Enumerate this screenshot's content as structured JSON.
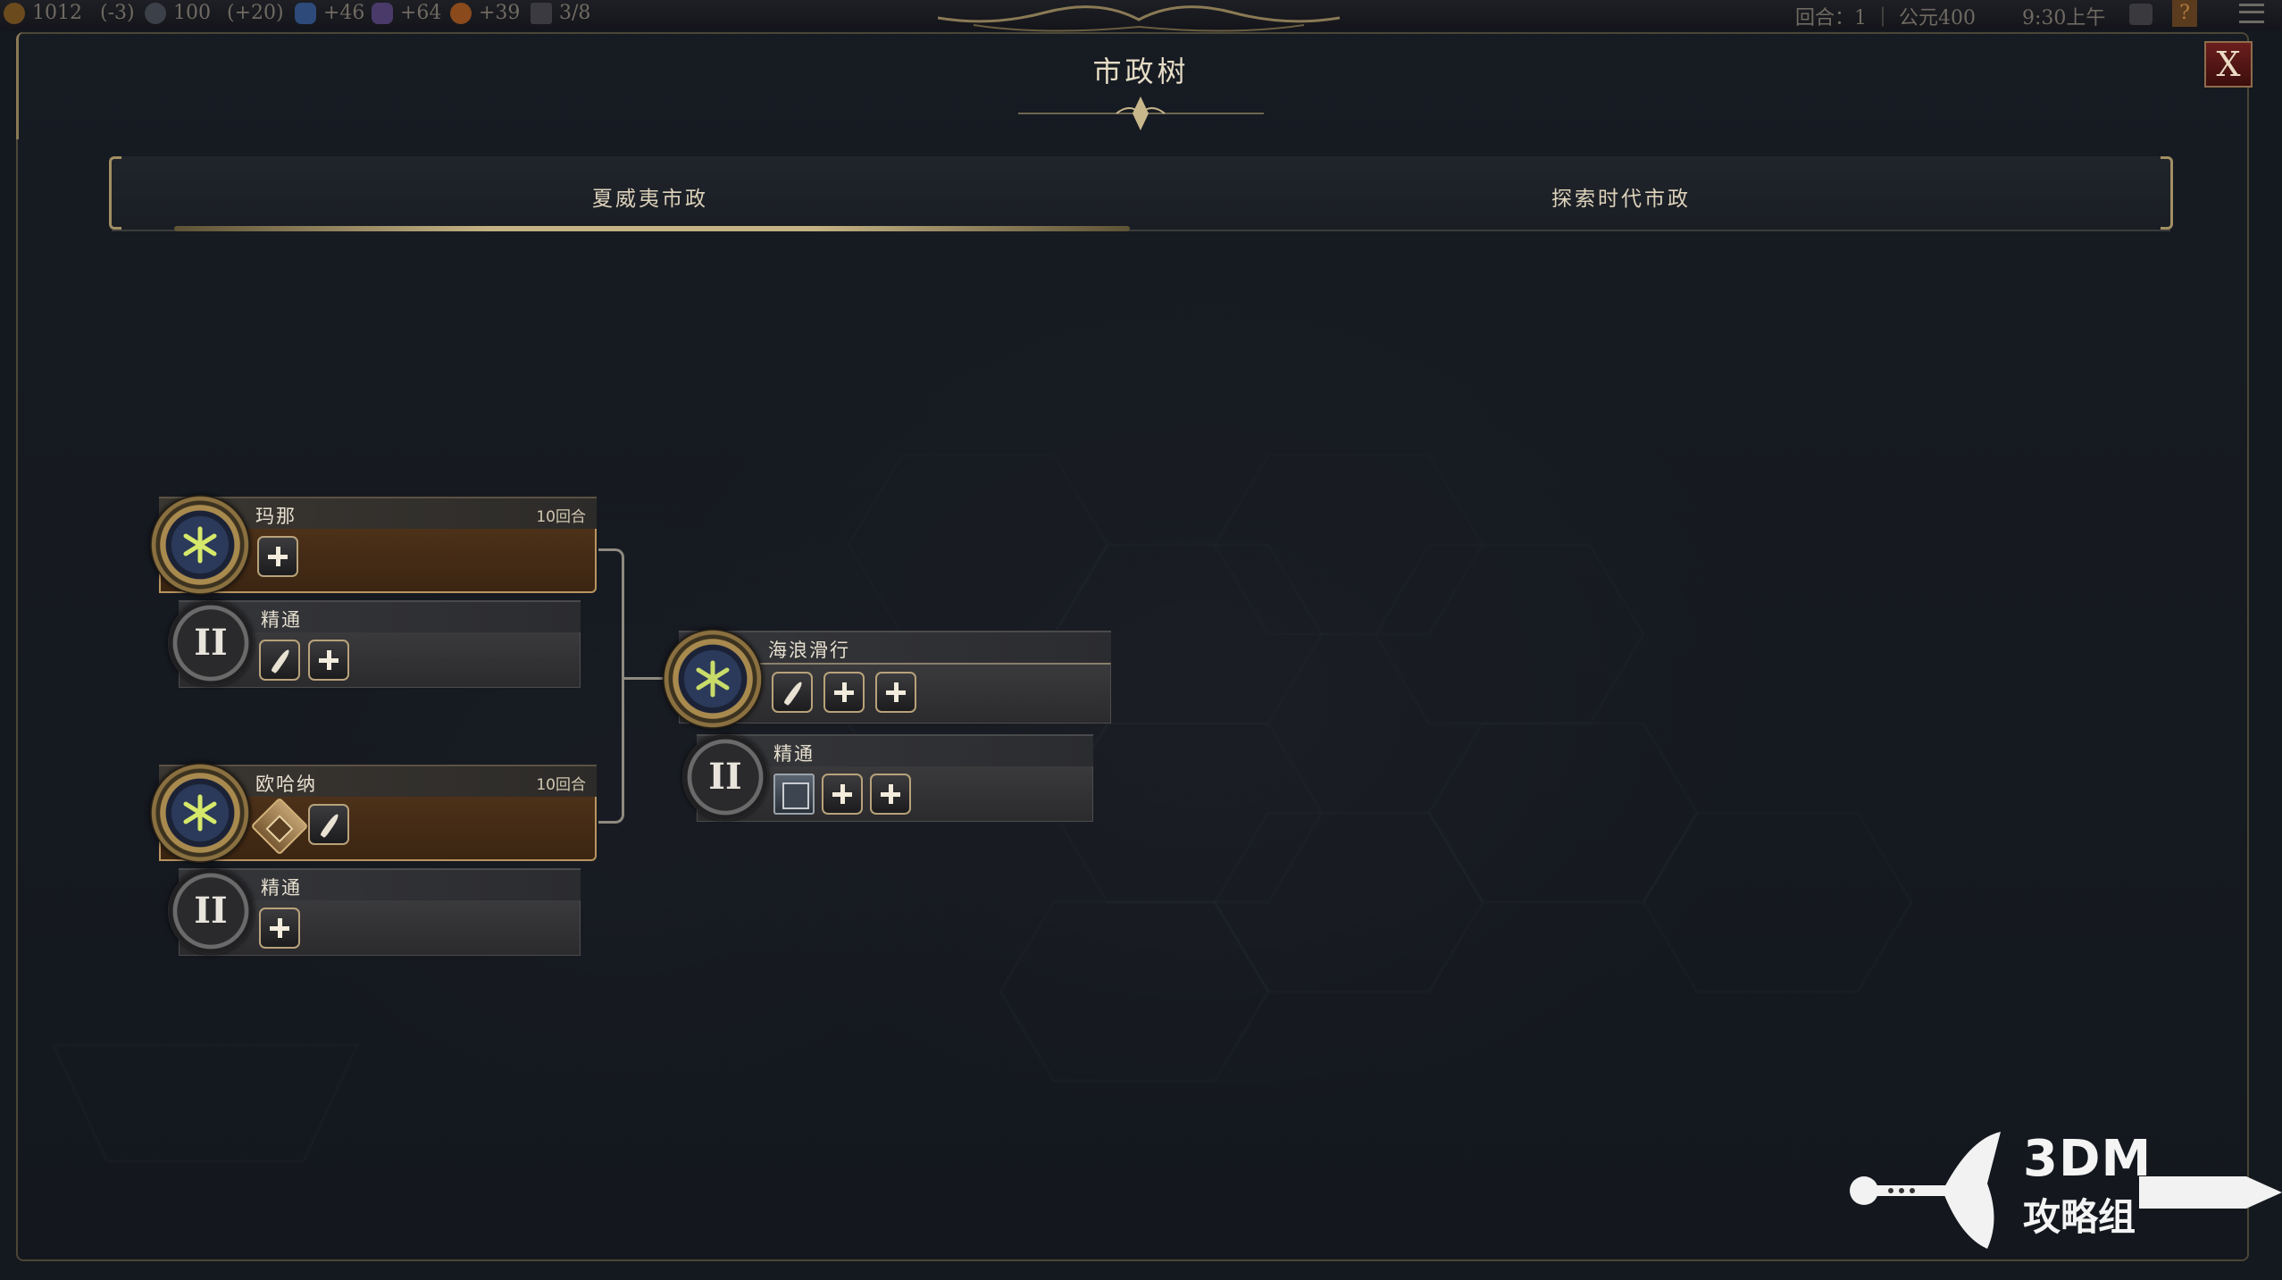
{
  "topbar": {
    "gold": "1012",
    "gold_delta": "(-3)",
    "faith": "100",
    "faith_delta": "(+20)",
    "science": "+46",
    "culture": "+64",
    "happiness": "+39",
    "cities": "3/8",
    "turn": "回合：1 ｜ 公元400",
    "time": "9:30上午"
  },
  "window": {
    "title": "市政树",
    "close_label": "X"
  },
  "tabs": [
    {
      "label": "夏威夷市政",
      "active": true
    },
    {
      "label": "探索时代市政",
      "active": false
    }
  ],
  "tree": {
    "mana": {
      "name": "玛那",
      "turns": "10回合"
    },
    "mana_mastery": {
      "name": "精通",
      "numeral": "II"
    },
    "ohana": {
      "name": "欧哈纳",
      "turns": "10回合"
    },
    "ohana_mastery": {
      "name": "精通",
      "numeral": "II"
    },
    "wave": {
      "name": "海浪滑行"
    },
    "wave_mastery": {
      "name": "精通",
      "numeral": "II"
    }
  },
  "icons": {
    "civic_medal": "hawaiian-civic-emblem-icon",
    "plus": "plus-icon",
    "feather": "feather-icon",
    "building": "building-icon",
    "unit": "unit-portrait-icon"
  },
  "colors": {
    "civic_body": "#4d3119",
    "accent_gold": "#c6b385",
    "close_red": "#6a1e1c"
  },
  "watermark": {
    "brand": "3DM",
    "sub": "攻略组"
  }
}
